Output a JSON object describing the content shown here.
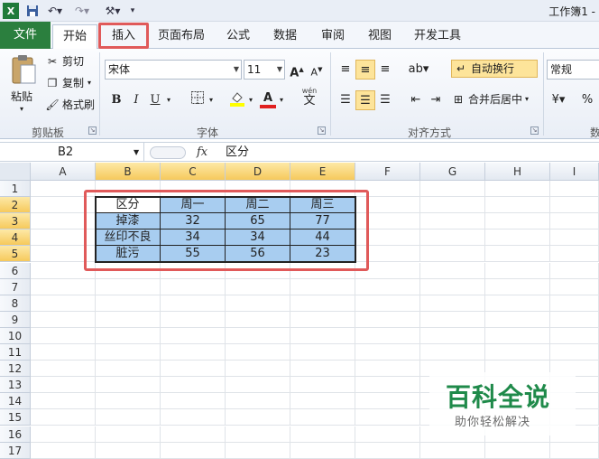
{
  "window": {
    "title": "工作簿1 -"
  },
  "quick_access": {
    "save_icon": "save-icon",
    "undo_icon": "undo-icon",
    "redo_icon": "redo-icon",
    "customize_icon": "tools-icon"
  },
  "tabs": [
    {
      "label": "文件"
    },
    {
      "label": "开始"
    },
    {
      "label": "插入"
    },
    {
      "label": "页面布局"
    },
    {
      "label": "公式"
    },
    {
      "label": "数据"
    },
    {
      "label": "审阅"
    },
    {
      "label": "视图"
    },
    {
      "label": "开发工具"
    }
  ],
  "clipboard": {
    "paste": "粘贴",
    "cut": "剪切",
    "copy": "复制",
    "format_painter": "格式刷",
    "group": "剪贴板"
  },
  "font": {
    "name": "宋体",
    "size": "11",
    "group": "字体",
    "bold": "B",
    "italic": "I",
    "underline": "U",
    "grow": "A",
    "shrink": "A",
    "font_color": "A",
    "phonetic_top": "wén",
    "phonetic_bottom": "文"
  },
  "alignment": {
    "wrap": "自动换行",
    "merge": "合并后居中",
    "group": "对齐方式"
  },
  "number": {
    "format": "常规",
    "percent": "%",
    "group": "数"
  },
  "formula_bar": {
    "cell_ref": "B2",
    "fx": "fx",
    "value": "区分"
  },
  "columns": [
    "A",
    "B",
    "C",
    "D",
    "E",
    "F",
    "G",
    "H",
    "I"
  ],
  "rows": [
    "1",
    "2",
    "3",
    "4",
    "5",
    "6",
    "7",
    "8",
    "9",
    "10",
    "11",
    "12",
    "13",
    "14",
    "15",
    "16",
    "17"
  ],
  "table": {
    "headers": [
      "区分",
      "周一",
      "周二",
      "周三"
    ],
    "rows": [
      [
        "掉漆",
        "32",
        "65",
        "77"
      ],
      [
        "丝印不良",
        "34",
        "34",
        "44"
      ],
      [
        "脏污",
        "55",
        "56",
        "23"
      ]
    ]
  },
  "watermark": {
    "title": "百科全说",
    "subtitle": "助你轻松解决"
  }
}
